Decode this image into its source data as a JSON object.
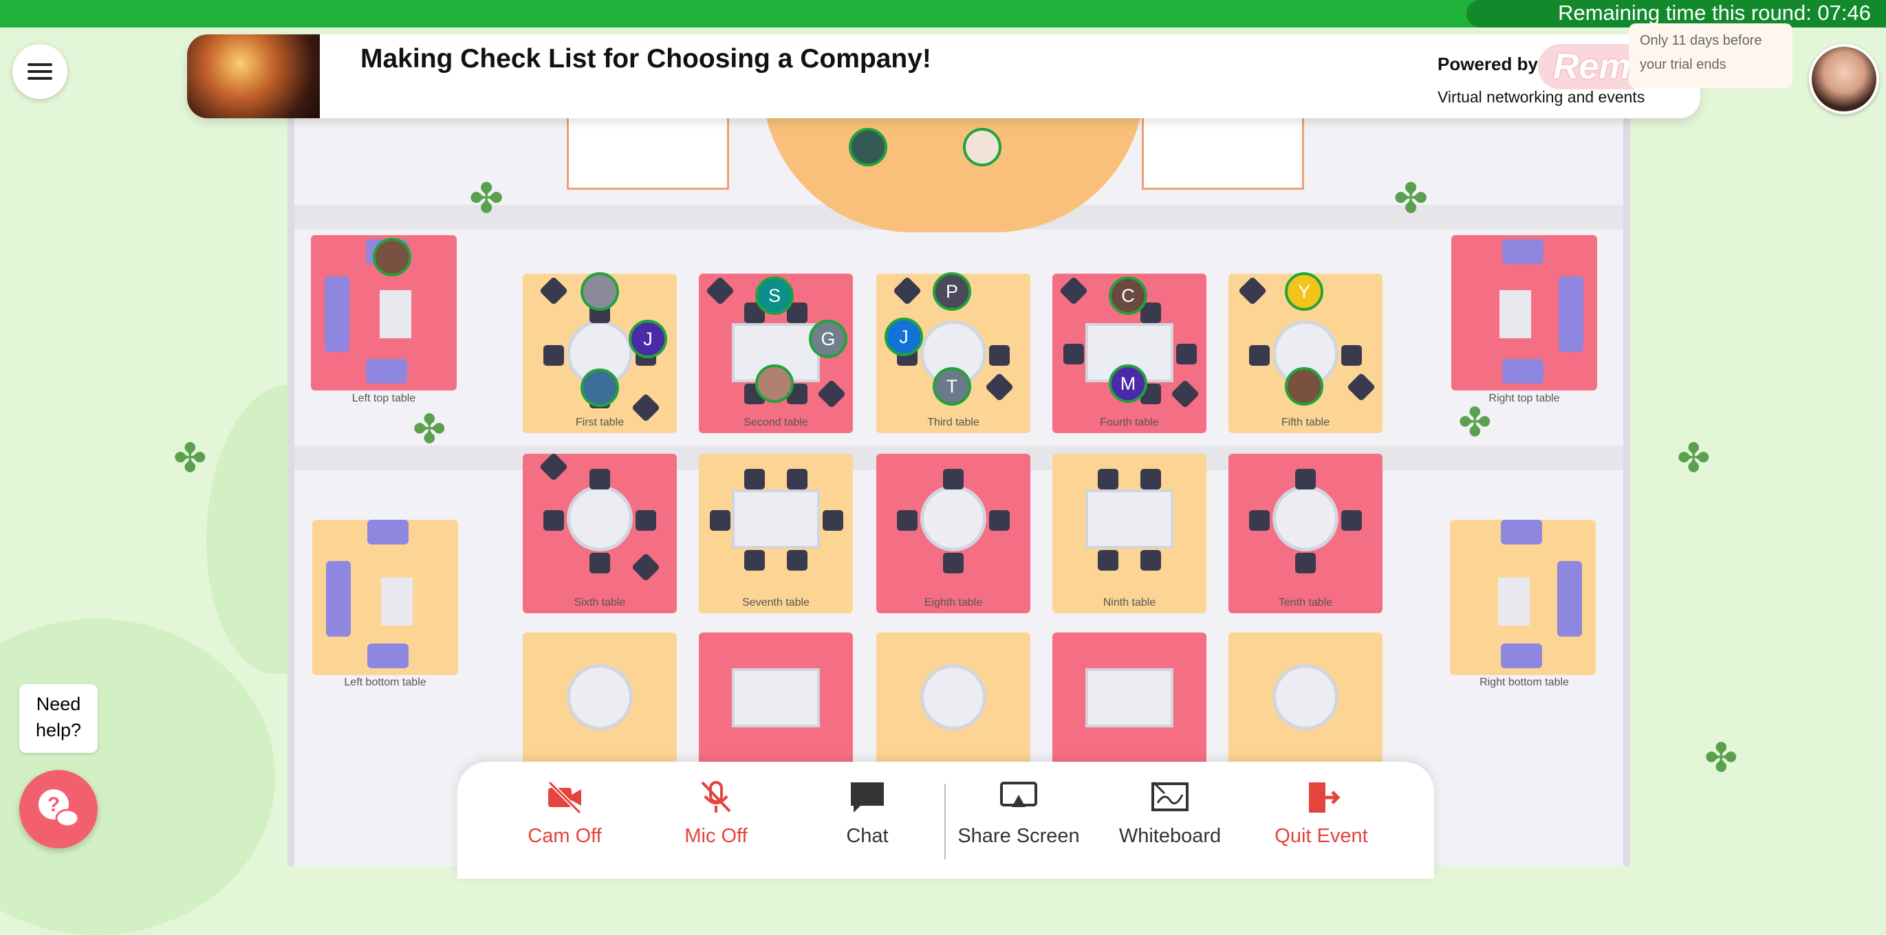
{
  "timer": {
    "label": "Remaining time this round: 07:46"
  },
  "event": {
    "title": "Making Check List for Choosing a Company!"
  },
  "branding": {
    "powered_by": "Powered by",
    "logo_text": "Rem",
    "tagline": "Virtual networking and events"
  },
  "trial_notice": "Only 11 days before your trial ends",
  "tables": {
    "left_top": "Left top table",
    "first": "First table",
    "second": "Second table",
    "third": "Third table",
    "fourth": "Fourth table",
    "fifth": "Fifth table",
    "right_top": "Right top table",
    "sixth": "Sixth table",
    "seventh": "Seventh table",
    "eighth": "Eighth table",
    "ninth": "Ninth table",
    "tenth": "Tenth table",
    "left_bottom": "Left bottom table",
    "right_bottom": "Right bottom table"
  },
  "participants": {
    "s": "S",
    "j1": "J",
    "g": "G",
    "p": "P",
    "j2": "J",
    "t": "T",
    "c": "C",
    "m": "M",
    "y": "Y"
  },
  "toolbar": {
    "cam": "Cam Off",
    "mic": "Mic Off",
    "chat": "Chat",
    "share": "Share Screen",
    "whiteboard": "Whiteboard",
    "quit": "Quit Event"
  },
  "help": {
    "label": "Need help?"
  },
  "colors": {
    "accent_green": "#1fb23a",
    "danger": "#e5433e",
    "yellow_room": "#fcd594",
    "red_room": "#f56f84"
  }
}
